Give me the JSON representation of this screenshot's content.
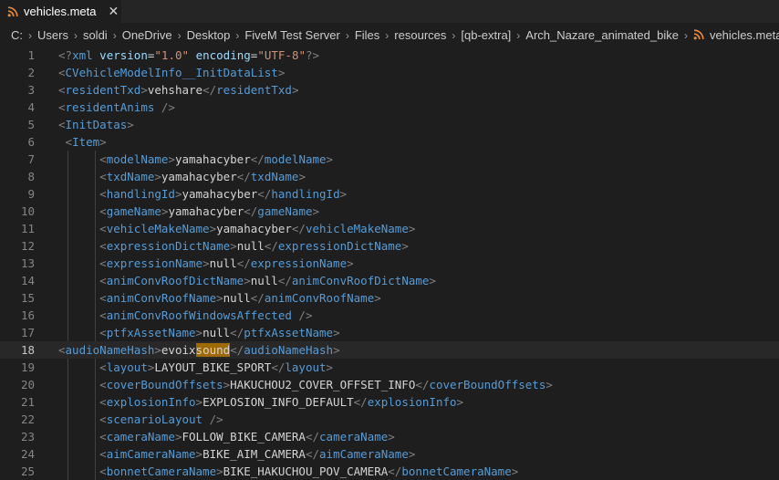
{
  "tab": {
    "title": "vehicles.meta",
    "close_glyph": "✕",
    "icon": "rss-icon",
    "icon_color": "#e8883a"
  },
  "breadcrumb": {
    "items": [
      "C:",
      "Users",
      "soldi",
      "OneDrive",
      "Desktop",
      "FiveM Test Server",
      "Files",
      "resources",
      "[qb-extra]",
      "Arch_Nazare_animated_bike"
    ],
    "file": "vehicles.meta",
    "separator": "›"
  },
  "editor": {
    "current_line": 18,
    "lines": [
      {
        "n": "1",
        "g": [],
        "t": [
          [
            "punct",
            "<?"
          ],
          [
            "tag",
            "xml"
          ],
          [
            "text",
            " "
          ],
          [
            "attr",
            "version"
          ],
          [
            "text",
            "="
          ],
          [
            "str",
            "\"1.0\""
          ],
          [
            "text",
            " "
          ],
          [
            "attr",
            "encoding"
          ],
          [
            "text",
            "="
          ],
          [
            "str",
            "\"UTF-8\""
          ],
          [
            "punct",
            "?>"
          ]
        ]
      },
      {
        "n": "2",
        "g": [],
        "t": [
          [
            "punct",
            "<"
          ],
          [
            "tag",
            "CVehicleModelInfo__InitDataList"
          ],
          [
            "punct",
            ">"
          ]
        ]
      },
      {
        "n": "3",
        "g": [],
        "t": [
          [
            "punct",
            "<"
          ],
          [
            "tag",
            "residentTxd"
          ],
          [
            "punct",
            ">"
          ],
          [
            "text",
            "vehshare"
          ],
          [
            "punct",
            "</"
          ],
          [
            "tag",
            "residentTxd"
          ],
          [
            "punct",
            ">"
          ]
        ]
      },
      {
        "n": "4",
        "g": [],
        "t": [
          [
            "punct",
            "<"
          ],
          [
            "tag",
            "residentAnims"
          ],
          [
            "text",
            " "
          ],
          [
            "punct",
            "/>"
          ]
        ]
      },
      {
        "n": "5",
        "g": [],
        "t": [
          [
            "punct",
            "<"
          ],
          [
            "tag",
            "InitDatas"
          ],
          [
            "punct",
            ">"
          ]
        ]
      },
      {
        "n": "6",
        "g": [],
        "t": [
          [
            "text",
            " "
          ],
          [
            "punct",
            "<"
          ],
          [
            "tag",
            "Item"
          ],
          [
            "punct",
            ">"
          ]
        ]
      },
      {
        "n": "7",
        "g": [
          1,
          2
        ],
        "t": [
          [
            "text",
            "      "
          ],
          [
            "punct",
            "<"
          ],
          [
            "tag",
            "modelName"
          ],
          [
            "punct",
            ">"
          ],
          [
            "text",
            "yamahacyber"
          ],
          [
            "punct",
            "</"
          ],
          [
            "tag",
            "modelName"
          ],
          [
            "punct",
            ">"
          ]
        ]
      },
      {
        "n": "8",
        "g": [
          1,
          2
        ],
        "t": [
          [
            "text",
            "      "
          ],
          [
            "punct",
            "<"
          ],
          [
            "tag",
            "txdName"
          ],
          [
            "punct",
            ">"
          ],
          [
            "text",
            "yamahacyber"
          ],
          [
            "punct",
            "</"
          ],
          [
            "tag",
            "txdName"
          ],
          [
            "punct",
            ">"
          ]
        ]
      },
      {
        "n": "9",
        "g": [
          1,
          2
        ],
        "t": [
          [
            "text",
            "      "
          ],
          [
            "punct",
            "<"
          ],
          [
            "tag",
            "handlingId"
          ],
          [
            "punct",
            ">"
          ],
          [
            "text",
            "yamahacyber"
          ],
          [
            "punct",
            "</"
          ],
          [
            "tag",
            "handlingId"
          ],
          [
            "punct",
            ">"
          ]
        ]
      },
      {
        "n": "10",
        "g": [
          1,
          2
        ],
        "t": [
          [
            "text",
            "      "
          ],
          [
            "punct",
            "<"
          ],
          [
            "tag",
            "gameName"
          ],
          [
            "punct",
            ">"
          ],
          [
            "text",
            "yamahacyber"
          ],
          [
            "punct",
            "</"
          ],
          [
            "tag",
            "gameName"
          ],
          [
            "punct",
            ">"
          ]
        ]
      },
      {
        "n": "11",
        "g": [
          1,
          2
        ],
        "t": [
          [
            "text",
            "      "
          ],
          [
            "punct",
            "<"
          ],
          [
            "tag",
            "vehicleMakeName"
          ],
          [
            "punct",
            ">"
          ],
          [
            "text",
            "yamahacyber"
          ],
          [
            "punct",
            "</"
          ],
          [
            "tag",
            "vehicleMakeName"
          ],
          [
            "punct",
            ">"
          ]
        ]
      },
      {
        "n": "12",
        "g": [
          1,
          2
        ],
        "t": [
          [
            "text",
            "      "
          ],
          [
            "punct",
            "<"
          ],
          [
            "tag",
            "expressionDictName"
          ],
          [
            "punct",
            ">"
          ],
          [
            "text",
            "null"
          ],
          [
            "punct",
            "</"
          ],
          [
            "tag",
            "expressionDictName"
          ],
          [
            "punct",
            ">"
          ]
        ]
      },
      {
        "n": "13",
        "g": [
          1,
          2
        ],
        "t": [
          [
            "text",
            "      "
          ],
          [
            "punct",
            "<"
          ],
          [
            "tag",
            "expressionName"
          ],
          [
            "punct",
            ">"
          ],
          [
            "text",
            "null"
          ],
          [
            "punct",
            "</"
          ],
          [
            "tag",
            "expressionName"
          ],
          [
            "punct",
            ">"
          ]
        ]
      },
      {
        "n": "14",
        "g": [
          1,
          2
        ],
        "t": [
          [
            "text",
            "      "
          ],
          [
            "punct",
            "<"
          ],
          [
            "tag",
            "animConvRoofDictName"
          ],
          [
            "punct",
            ">"
          ],
          [
            "text",
            "null"
          ],
          [
            "punct",
            "</"
          ],
          [
            "tag",
            "animConvRoofDictName"
          ],
          [
            "punct",
            ">"
          ]
        ]
      },
      {
        "n": "15",
        "g": [
          1,
          2
        ],
        "t": [
          [
            "text",
            "      "
          ],
          [
            "punct",
            "<"
          ],
          [
            "tag",
            "animConvRoofName"
          ],
          [
            "punct",
            ">"
          ],
          [
            "text",
            "null"
          ],
          [
            "punct",
            "</"
          ],
          [
            "tag",
            "animConvRoofName"
          ],
          [
            "punct",
            ">"
          ]
        ]
      },
      {
        "n": "16",
        "g": [
          1,
          2
        ],
        "t": [
          [
            "text",
            "      "
          ],
          [
            "punct",
            "<"
          ],
          [
            "tag",
            "animConvRoofWindowsAffected"
          ],
          [
            "text",
            " "
          ],
          [
            "punct",
            "/>"
          ]
        ]
      },
      {
        "n": "17",
        "g": [
          1,
          2
        ],
        "t": [
          [
            "text",
            "      "
          ],
          [
            "punct",
            "<"
          ],
          [
            "tag",
            "ptfxAssetName"
          ],
          [
            "punct",
            ">"
          ],
          [
            "text",
            "null"
          ],
          [
            "punct",
            "</"
          ],
          [
            "tag",
            "ptfxAssetName"
          ],
          [
            "punct",
            ">"
          ]
        ]
      },
      {
        "n": "18",
        "g": [],
        "t": [
          [
            "punct",
            "<"
          ],
          [
            "tag",
            "audioNameHash"
          ],
          [
            "punct",
            ">"
          ],
          [
            "text",
            "evoix"
          ],
          [
            "hl",
            "sound"
          ],
          [
            "punct",
            "</"
          ],
          [
            "tag",
            "audioNameHash"
          ],
          [
            "punct",
            ">"
          ]
        ]
      },
      {
        "n": "19",
        "g": [
          1,
          2
        ],
        "t": [
          [
            "text",
            "      "
          ],
          [
            "punct",
            "<"
          ],
          [
            "tag",
            "layout"
          ],
          [
            "punct",
            ">"
          ],
          [
            "text",
            "LAYOUT_BIKE_SPORT"
          ],
          [
            "punct",
            "</"
          ],
          [
            "tag",
            "layout"
          ],
          [
            "punct",
            ">"
          ]
        ]
      },
      {
        "n": "20",
        "g": [
          1,
          2
        ],
        "t": [
          [
            "text",
            "      "
          ],
          [
            "punct",
            "<"
          ],
          [
            "tag",
            "coverBoundOffsets"
          ],
          [
            "punct",
            ">"
          ],
          [
            "text",
            "HAKUCHOU2_COVER_OFFSET_INFO"
          ],
          [
            "punct",
            "</"
          ],
          [
            "tag",
            "coverBoundOffsets"
          ],
          [
            "punct",
            ">"
          ]
        ]
      },
      {
        "n": "21",
        "g": [
          1,
          2
        ],
        "t": [
          [
            "text",
            "      "
          ],
          [
            "punct",
            "<"
          ],
          [
            "tag",
            "explosionInfo"
          ],
          [
            "punct",
            ">"
          ],
          [
            "text",
            "EXPLOSION_INFO_DEFAULT"
          ],
          [
            "punct",
            "</"
          ],
          [
            "tag",
            "explosionInfo"
          ],
          [
            "punct",
            ">"
          ]
        ]
      },
      {
        "n": "22",
        "g": [
          1,
          2
        ],
        "t": [
          [
            "text",
            "      "
          ],
          [
            "punct",
            "<"
          ],
          [
            "tag",
            "scenarioLayout"
          ],
          [
            "text",
            " "
          ],
          [
            "punct",
            "/>"
          ]
        ]
      },
      {
        "n": "23",
        "g": [
          1,
          2
        ],
        "t": [
          [
            "text",
            "      "
          ],
          [
            "punct",
            "<"
          ],
          [
            "tag",
            "cameraName"
          ],
          [
            "punct",
            ">"
          ],
          [
            "text",
            "FOLLOW_BIKE_CAMERA"
          ],
          [
            "punct",
            "</"
          ],
          [
            "tag",
            "cameraName"
          ],
          [
            "punct",
            ">"
          ]
        ]
      },
      {
        "n": "24",
        "g": [
          1,
          2
        ],
        "t": [
          [
            "text",
            "      "
          ],
          [
            "punct",
            "<"
          ],
          [
            "tag",
            "aimCameraName"
          ],
          [
            "punct",
            ">"
          ],
          [
            "text",
            "BIKE_AIM_CAMERA"
          ],
          [
            "punct",
            "</"
          ],
          [
            "tag",
            "aimCameraName"
          ],
          [
            "punct",
            ">"
          ]
        ]
      },
      {
        "n": "25",
        "g": [
          1,
          2
        ],
        "t": [
          [
            "text",
            "      "
          ],
          [
            "punct",
            "<"
          ],
          [
            "tag",
            "bonnetCameraName"
          ],
          [
            "punct",
            ">"
          ],
          [
            "text",
            "BIKE_HAKUCHOU_POV_CAMERA"
          ],
          [
            "punct",
            "</"
          ],
          [
            "tag",
            "bonnetCameraName"
          ],
          [
            "punct",
            ">"
          ]
        ]
      }
    ]
  }
}
